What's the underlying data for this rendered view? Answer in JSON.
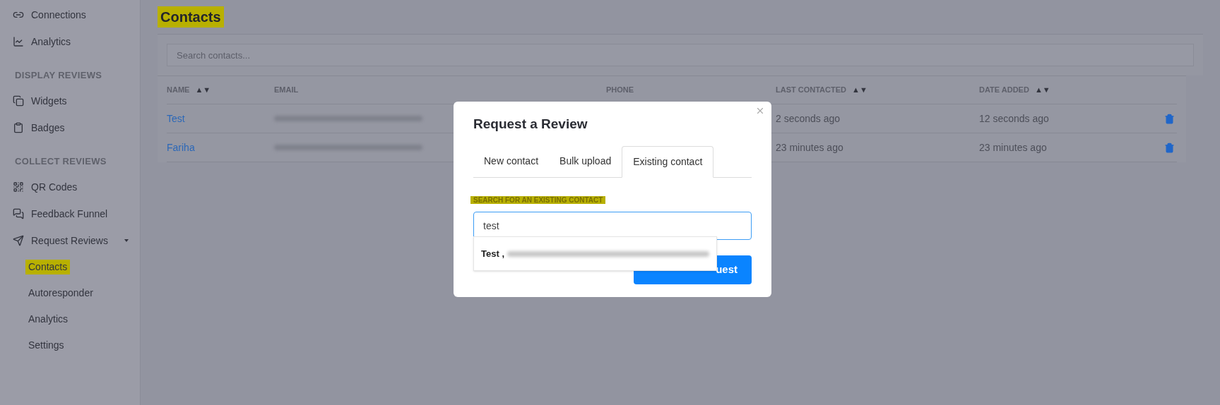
{
  "sidebar": {
    "items": [
      {
        "kind": "link",
        "label": "Connections",
        "highlighted": false
      },
      {
        "kind": "link",
        "label": "Analytics",
        "highlighted": false
      },
      {
        "kind": "heading",
        "label": "DISPLAY REVIEWS"
      },
      {
        "kind": "link",
        "label": "Widgets",
        "highlighted": false
      },
      {
        "kind": "link",
        "label": "Badges",
        "highlighted": false
      },
      {
        "kind": "heading",
        "label": "COLLECT REVIEWS"
      },
      {
        "kind": "link",
        "label": "QR Codes",
        "highlighted": false
      },
      {
        "kind": "link",
        "label": "Feedback Funnel",
        "highlighted": false
      },
      {
        "kind": "group",
        "label": "Request Reviews",
        "expanded": true,
        "children": [
          {
            "label": "Contacts",
            "highlighted": true
          },
          {
            "label": "Autoresponder",
            "highlighted": false
          },
          {
            "label": "Analytics",
            "highlighted": false
          },
          {
            "label": "Settings",
            "highlighted": false
          }
        ]
      }
    ]
  },
  "page": {
    "title": "Contacts",
    "title_highlighted": true,
    "search": {
      "placeholder": "Search contacts..."
    },
    "table": {
      "columns": [
        {
          "label": "NAME",
          "sort": "▲▼"
        },
        {
          "label": "EMAIL"
        },
        {
          "label": "PHONE"
        },
        {
          "label": "LAST CONTACTED",
          "sort": "▲▼"
        },
        {
          "label": "DATE ADDED",
          "sort": "▲▼"
        }
      ],
      "rows": [
        {
          "name": "Test",
          "last_contacted": "2 seconds ago",
          "date_added": "12 seconds ago"
        },
        {
          "name": "Fariha",
          "last_contacted": "23 minutes ago",
          "date_added": "23 minutes ago"
        }
      ]
    }
  },
  "modal": {
    "title": "Request a Review",
    "tabs": [
      {
        "label": "New contact",
        "selected": false
      },
      {
        "label": "Bulk upload",
        "selected": false
      },
      {
        "label": "Existing contact",
        "selected": true
      }
    ],
    "field_label": "SEARCH FOR AN EXISTING CONTACT",
    "field_label_highlighted": true,
    "field_value": "test",
    "suggestion": {
      "name": "Test ,"
    },
    "submit_button": "uest"
  }
}
